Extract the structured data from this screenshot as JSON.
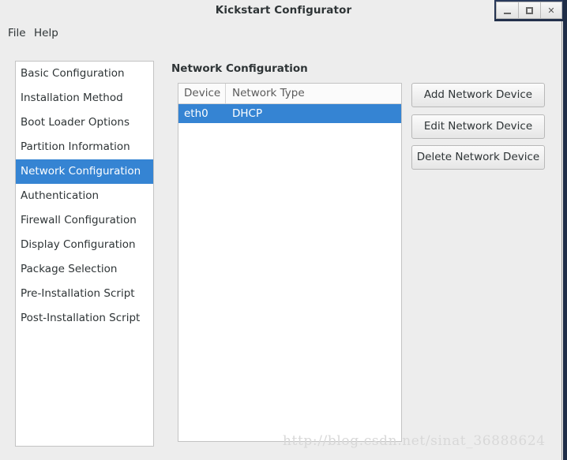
{
  "window": {
    "title": "Kickstart Configurator",
    "controls": [
      {
        "name": "minimize",
        "label": "_"
      },
      {
        "name": "maximize",
        "label": "□"
      },
      {
        "name": "close",
        "label": "✕"
      }
    ]
  },
  "menubar": {
    "items": [
      {
        "label": "File"
      },
      {
        "label": "Help"
      }
    ]
  },
  "sidebar": {
    "selected_index": 4,
    "items": [
      {
        "label": "Basic Configuration"
      },
      {
        "label": "Installation Method"
      },
      {
        "label": "Boot Loader Options"
      },
      {
        "label": "Partition Information"
      },
      {
        "label": "Network Configuration"
      },
      {
        "label": "Authentication"
      },
      {
        "label": "Firewall Configuration"
      },
      {
        "label": "Display Configuration"
      },
      {
        "label": "Package Selection"
      },
      {
        "label": "Pre-Installation Script"
      },
      {
        "label": "Post-Installation Script"
      }
    ]
  },
  "main": {
    "title": "Network Configuration",
    "table": {
      "columns": [
        {
          "key": "device",
          "label": "Device"
        },
        {
          "key": "network_type",
          "label": "Network Type"
        }
      ],
      "rows": [
        {
          "device": "eth0",
          "network_type": "DHCP",
          "selected": true
        }
      ]
    },
    "buttons": [
      {
        "name": "add-network-device-button",
        "label": "Add Network Device"
      },
      {
        "name": "edit-network-device-button",
        "label": "Edit Network Device"
      },
      {
        "name": "delete-network-device-button",
        "label": "Delete Network Device"
      }
    ]
  },
  "watermark": {
    "text": "http://blog.csdn.net/sinat_36888624"
  },
  "colors": {
    "selection_blue": "#3584d3",
    "window_bg": "#ededed",
    "panel_bg": "#ffffff",
    "text": "#2e3436",
    "titlebar_accent": "#1f2d47"
  }
}
